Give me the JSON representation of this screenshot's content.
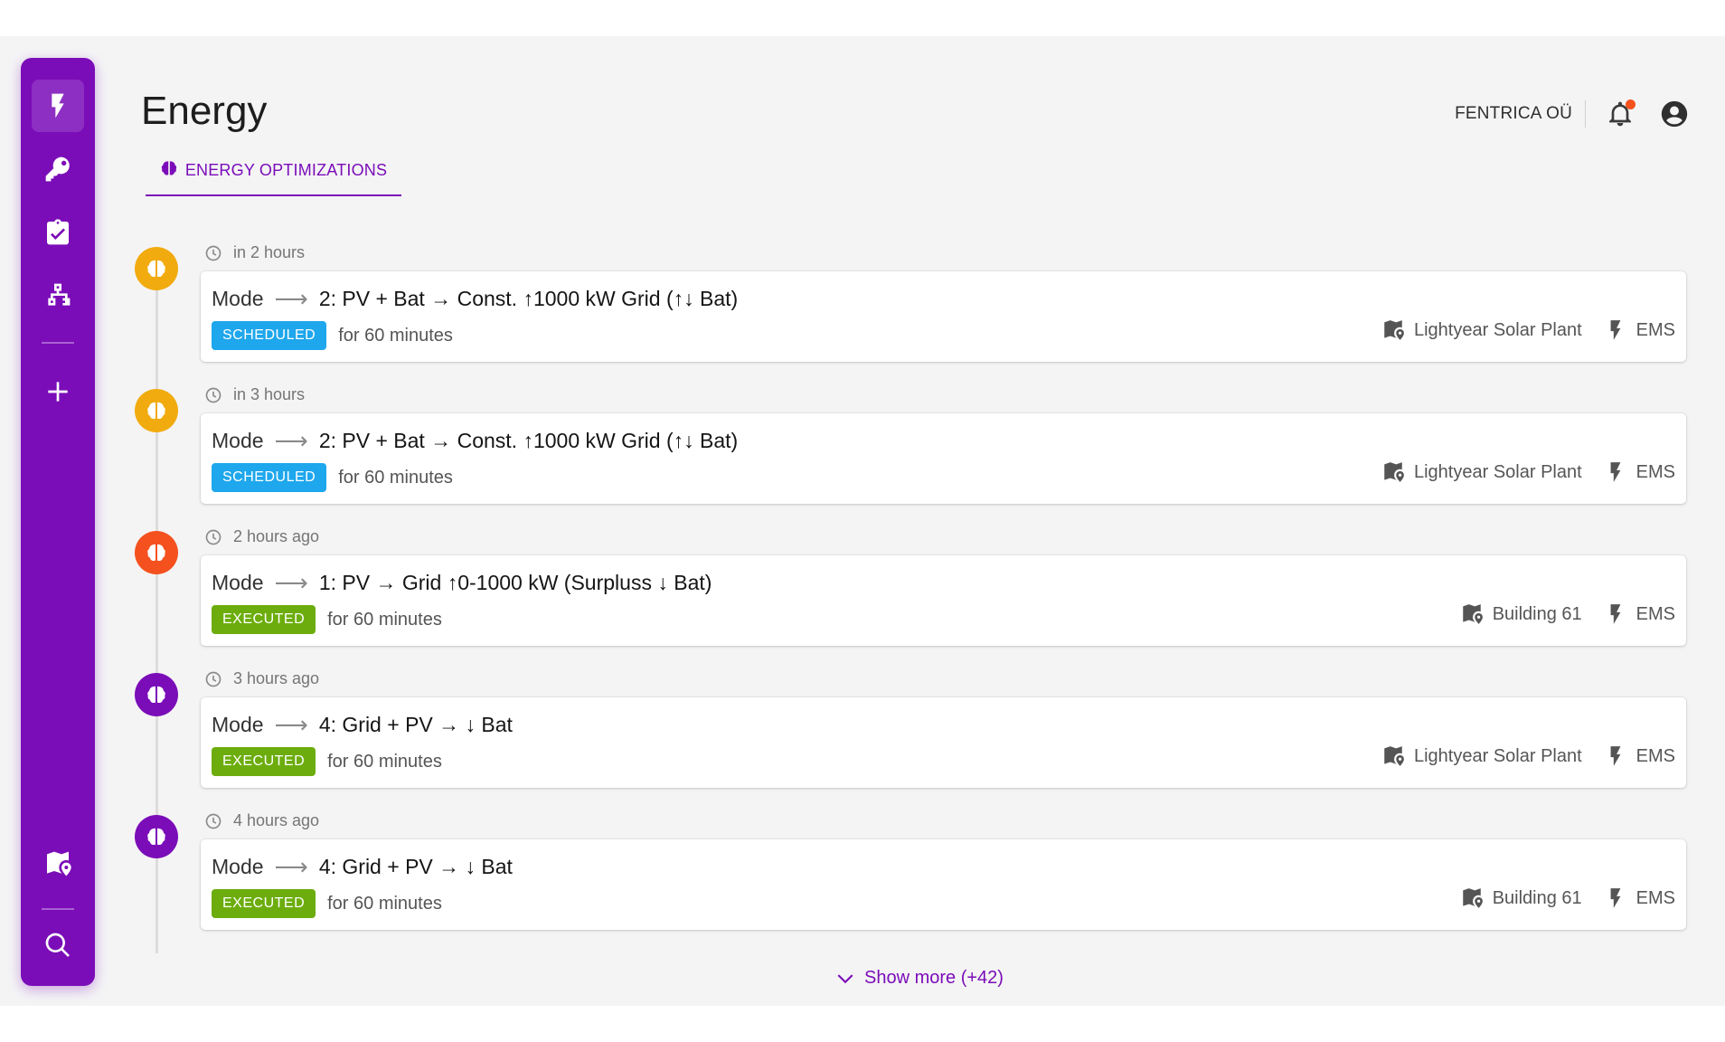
{
  "header": {
    "title": "Energy",
    "organization": "FENTRICA OÜ"
  },
  "tabs": [
    {
      "label": "ENERGY OPTIMIZATIONS"
    }
  ],
  "sidebar": {
    "items": [
      "energy",
      "key",
      "checklist",
      "network",
      "add",
      "sites-map",
      "search"
    ]
  },
  "colors": {
    "accent": "#7b0db8",
    "scheduled": "#1ea7ec",
    "executed": "#6cad0d",
    "marker_orange": "#f1ab0e",
    "marker_red": "#f4511e",
    "marker_purple": "#7b0db8"
  },
  "entries": [
    {
      "time": "in 2 hours",
      "mode_label": "Mode",
      "mode_value": "2: PV + Bat → Const. ↑1000 kW Grid (↑↓ Bat)",
      "status": "SCHEDULED",
      "duration": "for 60 minutes",
      "site": "Lightyear Solar Plant",
      "system": "EMS"
    },
    {
      "time": "in 3 hours",
      "mode_label": "Mode",
      "mode_value": "2: PV + Bat → Const. ↑1000 kW Grid (↑↓ Bat)",
      "status": "SCHEDULED",
      "duration": "for 60 minutes",
      "site": "Lightyear Solar Plant",
      "system": "EMS"
    },
    {
      "time": "2 hours ago",
      "mode_label": "Mode",
      "mode_value": "1: PV → Grid ↑0-1000 kW (Surpluss ↓ Bat)",
      "status": "EXECUTED",
      "duration": "for 60 minutes",
      "site": "Building 61",
      "system": "EMS"
    },
    {
      "time": "3 hours ago",
      "mode_label": "Mode",
      "mode_value": "4: Grid + PV → ↓ Bat",
      "status": "EXECUTED",
      "duration": "for 60 minutes",
      "site": "Lightyear Solar Plant",
      "system": "EMS"
    },
    {
      "time": "4 hours ago",
      "mode_label": "Mode",
      "mode_value": "4: Grid + PV → ↓ Bat",
      "status": "EXECUTED",
      "duration": "for 60 minutes",
      "site": "Building 61",
      "system": "EMS"
    }
  ],
  "show_more": "Show more (+42)"
}
